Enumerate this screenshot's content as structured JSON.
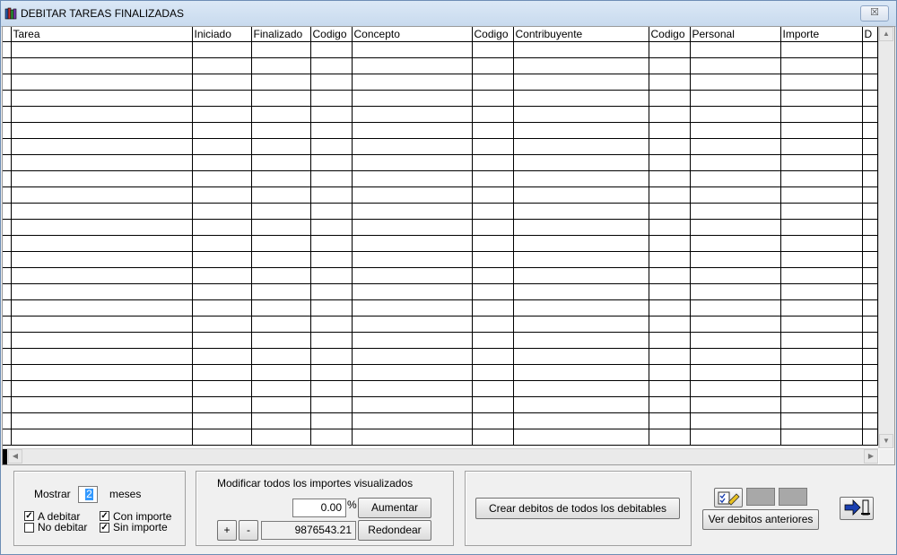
{
  "window": {
    "title": "DEBITAR TAREAS FINALIZADAS",
    "close_label": "☒"
  },
  "grid": {
    "columns": [
      {
        "label": "Tarea"
      },
      {
        "label": "Iniciado"
      },
      {
        "label": "Finalizado"
      },
      {
        "label": "Codigo"
      },
      {
        "label": "Concepto"
      },
      {
        "label": "Codigo"
      },
      {
        "label": "Contribuyente"
      },
      {
        "label": "Codigo"
      },
      {
        "label": "Personal"
      },
      {
        "label": "Importe"
      },
      {
        "label": "D"
      }
    ],
    "row_count": 25
  },
  "filter_panel": {
    "mostrar_label": "Mostrar",
    "months_value": "2",
    "meses_label": "meses",
    "checkboxes": {
      "a_debitar": {
        "label": "A debitar",
        "checked": true
      },
      "no_debitar": {
        "label": "No debitar",
        "checked": false
      },
      "con_importe": {
        "label": "Con importe",
        "checked": true
      },
      "sin_importe": {
        "label": "Sin importe",
        "checked": true
      }
    }
  },
  "modify_panel": {
    "title": "Modificar todos los importes visualizados",
    "percent_value": "0.00",
    "percent_sign": "%",
    "aumentar_label": "Aumentar",
    "plus_label": "+",
    "minus_label": "-",
    "amount_value": "9876543.21",
    "redondear_label": "Redondear"
  },
  "create_panel": {
    "crear_label": "Crear debitos de todos los debitables"
  },
  "actions": {
    "ver_label": "Ver debitos anteriores"
  }
}
